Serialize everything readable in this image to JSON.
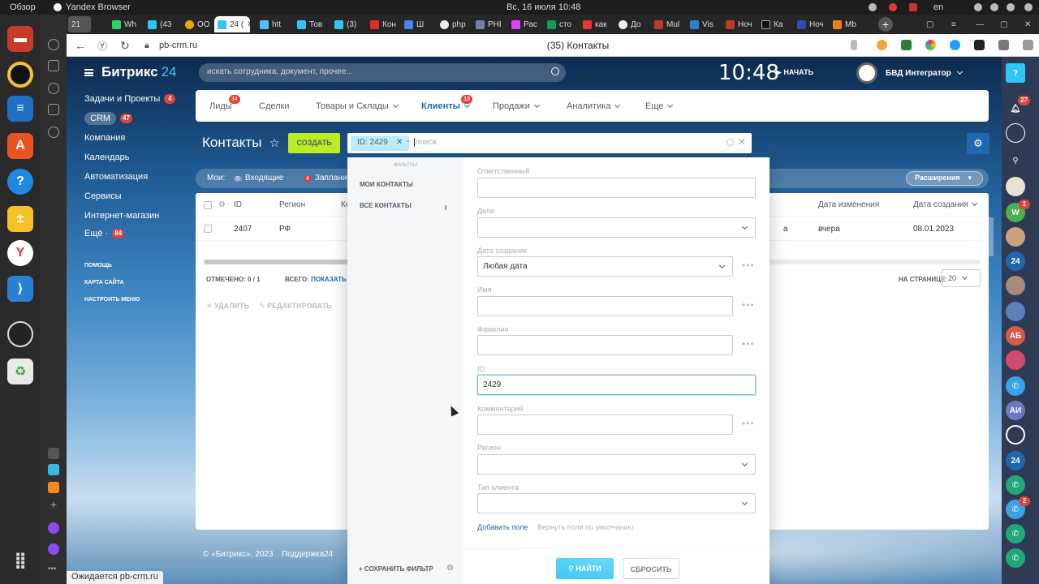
{
  "os": {
    "overview_label": "Обзор",
    "app_name": "Yandex Browser",
    "datetime": "Вс, 16 июля  10:48",
    "lang": "en"
  },
  "browser": {
    "tabs": [
      {
        "label": "Wh"
      },
      {
        "label": "(43"
      },
      {
        "label": "OO"
      },
      {
        "label": "24 ("
      },
      {
        "label": "htt"
      },
      {
        "label": "Тов"
      },
      {
        "label": "(3)"
      },
      {
        "label": "Кон"
      },
      {
        "label": "Ш"
      },
      {
        "label": "php"
      },
      {
        "label": "PHI"
      },
      {
        "label": "Рас"
      },
      {
        "label": "сто"
      },
      {
        "label": "как"
      },
      {
        "label": "До"
      },
      {
        "label": "Mul"
      },
      {
        "label": "Vis"
      },
      {
        "label": "Ноч"
      },
      {
        "label": "Ка"
      },
      {
        "label": "Ноч"
      },
      {
        "label": "Mb"
      }
    ],
    "tab_counter": "21",
    "url": "pb-crm.ru",
    "page_title": "(35) Контакты",
    "status_text": "Ожидается pb-crm.ru"
  },
  "portal": {
    "logo_text": "Битрикс",
    "logo_num": "24",
    "search_placeholder": "искать сотрудника, документ, прочее...",
    "clock": "10:48",
    "start_label": "НАЧАТЬ",
    "user_name": "БВД Интегратор",
    "left_menu": [
      {
        "label": "Задачи и Проекты",
        "badge": "4"
      },
      {
        "label": "CRM",
        "badge": "47"
      },
      {
        "label": "Компания",
        "badge": ""
      },
      {
        "label": "Календарь",
        "badge": ""
      },
      {
        "label": "Автоматизация",
        "badge": ""
      },
      {
        "label": "Сервисы",
        "badge": ""
      },
      {
        "label": "Интернет-магазин",
        "badge": ""
      },
      {
        "label": "Ещё ·",
        "badge": "84"
      }
    ],
    "left_links": [
      "ПОМОЩЬ",
      "КАРТА САЙТА",
      "НАСТРОИТЬ МЕНЮ"
    ],
    "top_nav": [
      {
        "label": "Лиды",
        "badge": "34"
      },
      {
        "label": "Сделки",
        "badge": ""
      },
      {
        "label": "Товары и Склады",
        "badge": ""
      },
      {
        "label": "Клиенты",
        "badge": "13"
      },
      {
        "label": "Продажи",
        "badge": ""
      },
      {
        "label": "Аналитика",
        "badge": ""
      },
      {
        "label": "Еще",
        "badge": ""
      }
    ],
    "page_heading": "Контакты",
    "create_label": "СОЗДАТЬ",
    "filter_chip": "ID: 2429",
    "filter_search_placeholder": "+ поиск",
    "my_bar": {
      "label": "Мои:",
      "incoming_count": "0",
      "incoming_label": "Входящие",
      "planned_count": "4",
      "planned_label": "Заплани"
    },
    "extensions_label": "Расширения",
    "grid": {
      "columns": [
        "ID",
        "Регион",
        "Ко",
        "Дата изменения",
        "Дата создания"
      ],
      "rows": [
        {
          "id": "2407",
          "region": "РФ",
          "tail": "а",
          "modified": "вчера",
          "created": "08.01.2023"
        }
      ],
      "selected_label": "ОТМЕЧЕНО:",
      "selected_value": "0 / 1",
      "total_label": "ВСЕГО:",
      "total_link": "ПОКАЗАТЬ КО",
      "per_page_label": "НА СТРАНИЦЕ:",
      "per_page_value": "20",
      "delete_label": "УДАЛИТЬ",
      "edit_label": "РЕДАКТИРОВАТЬ"
    },
    "footer": {
      "copyright": "© «Битрикс», 2023",
      "support": "Поддержка24"
    }
  },
  "filter_popup": {
    "left_title": "ФИЛЬТРЫ",
    "presets": [
      "МОИ КОНТАКТЫ",
      "ВСЕ КОНТАКТЫ"
    ],
    "save_label": "СОХРАНИТЬ ФИЛЬТР",
    "fields": [
      {
        "label": "Ответственный",
        "value": ""
      },
      {
        "label": "Дела",
        "value": ""
      },
      {
        "label": "Дата создания",
        "value": "Любая дата"
      },
      {
        "label": "Имя",
        "value": ""
      },
      {
        "label": "Фамилия",
        "value": ""
      },
      {
        "label": "ID",
        "value": "2429"
      },
      {
        "label": "Комментарий",
        "value": ""
      },
      {
        "label": "Регион",
        "value": ""
      },
      {
        "label": "Тип клиента",
        "value": ""
      }
    ],
    "add_field": "Добавить поле",
    "reset_fields": "Вернуть поля по умолчанию",
    "find_label": "НАЙТИ",
    "reset_label": "СБРОСИТЬ"
  },
  "right_sidebar": {
    "badges": [
      "27",
      "1",
      "2"
    ],
    "initials": [
      "АБ",
      "АИ"
    ]
  }
}
